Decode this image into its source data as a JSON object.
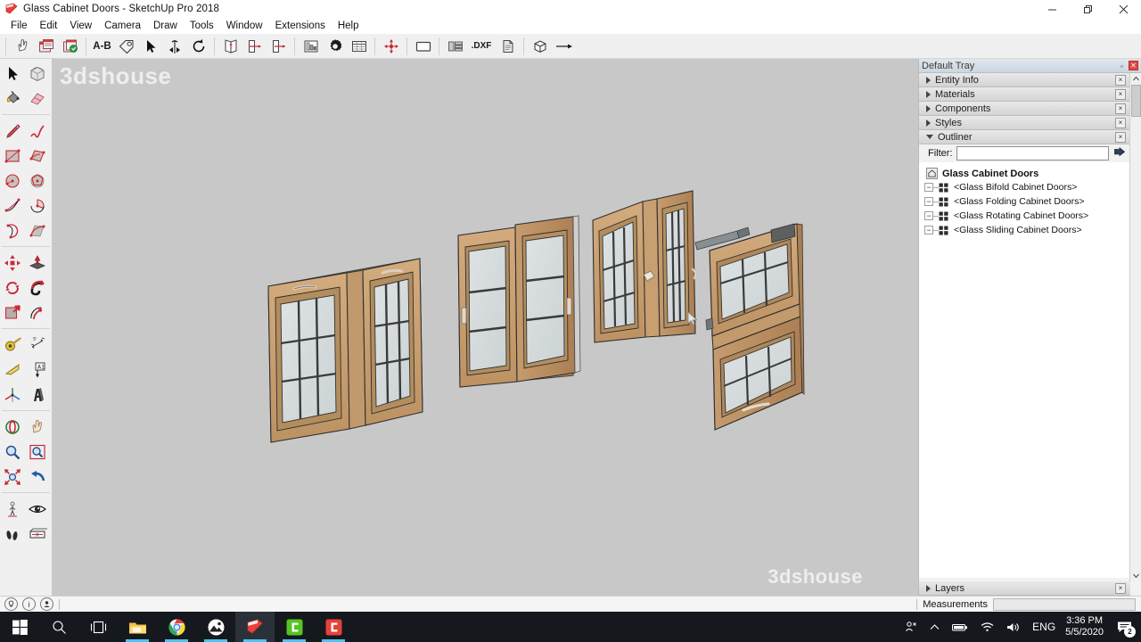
{
  "window": {
    "title": "Glass Cabinet Doors - SketchUp Pro 2018",
    "app_icon": "sketchup-icon",
    "minimize": "–",
    "maximize": "❐",
    "close": "✕"
  },
  "menubar": {
    "items": [
      {
        "label": "File"
      },
      {
        "label": "Edit"
      },
      {
        "label": "View"
      },
      {
        "label": "Camera"
      },
      {
        "label": "Draw"
      },
      {
        "label": "Tools"
      },
      {
        "label": "Window"
      },
      {
        "label": "Extensions"
      },
      {
        "label": "Help"
      }
    ]
  },
  "toolbar_top": {
    "buttons": [
      {
        "name": "select-hand-icon",
        "label": ""
      },
      {
        "name": "layout-open-icon",
        "label": ""
      },
      {
        "name": "layout-export-icon",
        "label": ""
      },
      {
        "name": "ab-label-icon",
        "label": "A-B"
      },
      {
        "name": "tag-icon",
        "label": ""
      },
      {
        "name": "arrow-select-icon",
        "label": ""
      },
      {
        "name": "mirror-icon",
        "label": ""
      },
      {
        "name": "rotate-refresh-icon",
        "label": ""
      },
      {
        "name": "open-door-icon",
        "label": ""
      },
      {
        "name": "door-left-icon",
        "label": ""
      },
      {
        "name": "door-right-icon",
        "label": ""
      },
      {
        "name": "bar-chart-icon",
        "label": ""
      },
      {
        "name": "gear-icon",
        "label": ""
      },
      {
        "name": "table-icon",
        "label": ""
      },
      {
        "name": "move-cross-icon",
        "label": ""
      },
      {
        "name": "rectangle-icon",
        "label": ""
      },
      {
        "name": "panel-layout-icon",
        "label": ""
      },
      {
        "name": "dxf-export-icon",
        "label": ".DXF"
      },
      {
        "name": "print-icon",
        "label": ""
      },
      {
        "name": "cube-icon",
        "label": ""
      },
      {
        "name": "arrow-right-icon",
        "label": ""
      }
    ]
  },
  "toolbar_left": {
    "groups": [
      {
        "tools": [
          {
            "name": "select-arrow-tool",
            "label": "Select"
          },
          {
            "name": "make-component-tool",
            "label": "Make Component"
          },
          {
            "name": "paint-bucket-tool",
            "label": "Paint Bucket"
          },
          {
            "name": "eraser-tool",
            "label": "Eraser"
          }
        ]
      },
      {
        "tools": [
          {
            "name": "line-tool",
            "label": "Line"
          },
          {
            "name": "freehand-tool",
            "label": "Freehand"
          },
          {
            "name": "rectangle-tool",
            "label": "Rectangle"
          },
          {
            "name": "rotated-rectangle-tool",
            "label": "Rotated Rectangle"
          },
          {
            "name": "circle-tool",
            "label": "Circle"
          },
          {
            "name": "polygon-tool",
            "label": "Polygon"
          },
          {
            "name": "arc-tool",
            "label": "Arc"
          },
          {
            "name": "pie-tool",
            "label": "Pie"
          },
          {
            "name": "two-point-arc-tool",
            "label": "2 Point Arc"
          },
          {
            "name": "three-point-arc-tool",
            "label": "3 Point Arc"
          }
        ]
      },
      {
        "tools": [
          {
            "name": "move-tool",
            "label": "Move"
          },
          {
            "name": "pushpull-tool",
            "label": "Push/Pull"
          },
          {
            "name": "rotate-tool",
            "label": "Rotate"
          },
          {
            "name": "followme-tool",
            "label": "Follow Me"
          },
          {
            "name": "scale-tool",
            "label": "Scale"
          },
          {
            "name": "offset-tool",
            "label": "Offset"
          }
        ]
      },
      {
        "tools": [
          {
            "name": "tape-measure-tool",
            "label": "Tape Measure"
          },
          {
            "name": "dimension-tool",
            "label": "Dimension"
          },
          {
            "name": "protractor-tool",
            "label": "Protractor"
          },
          {
            "name": "text-tool",
            "label": "Text"
          },
          {
            "name": "axes-tool",
            "label": "Axes"
          },
          {
            "name": "three-d-text-tool",
            "label": "3D Text"
          }
        ]
      },
      {
        "tools": [
          {
            "name": "orbit-tool",
            "label": "Orbit"
          },
          {
            "name": "pan-tool",
            "label": "Pan"
          },
          {
            "name": "zoom-tool",
            "label": "Zoom"
          },
          {
            "name": "zoom-window-tool",
            "label": "Zoom Window"
          },
          {
            "name": "zoom-extents-tool",
            "label": "Zoom Extents"
          },
          {
            "name": "previous-view-tool",
            "label": "Previous"
          }
        ]
      },
      {
        "tools": [
          {
            "name": "position-camera-tool",
            "label": "Position Camera"
          },
          {
            "name": "look-around-tool",
            "label": "Look Around"
          },
          {
            "name": "walk-tool",
            "label": "Walk"
          },
          {
            "name": "section-plane-tool",
            "label": "Section Plane"
          }
        ]
      }
    ]
  },
  "viewport": {
    "watermark_top": "3dshouse",
    "watermark_bottom": "3dshouse",
    "background_color": "#c8c8c8",
    "wood_color": "#c49a6c",
    "glass_color": "#d5dadb",
    "models": [
      {
        "name": "glass-bifold-cabinet-doors",
        "label": "Glass Bifold Cabinet Doors"
      },
      {
        "name": "glass-sliding-cabinet-doors",
        "label": "Glass Sliding Cabinet Doors"
      },
      {
        "name": "glass-folding-cabinet-doors",
        "label": "Glass Folding Cabinet Doors"
      },
      {
        "name": "glass-rotating-cabinet-doors",
        "label": "Glass Rotating Cabinet Doors"
      }
    ]
  },
  "tray": {
    "title": "Default Tray",
    "pin_glyph": "▫",
    "close_glyph": "✕",
    "panel_close_glyph": "×",
    "panels": [
      {
        "name": "entity-info",
        "label": "Entity Info",
        "expanded": false
      },
      {
        "name": "materials",
        "label": "Materials",
        "expanded": false
      },
      {
        "name": "components",
        "label": "Components",
        "expanded": false
      },
      {
        "name": "styles",
        "label": "Styles",
        "expanded": false
      },
      {
        "name": "outliner",
        "label": "Outliner",
        "expanded": true
      }
    ],
    "layers_panel": {
      "label": "Layers",
      "expanded": false
    },
    "outliner": {
      "filter_label": "Filter:",
      "filter_value": "",
      "filter_placeholder": "",
      "root": "Glass Cabinet Doors",
      "items": [
        {
          "label": "<Glass Bifold Cabinet Doors>"
        },
        {
          "label": "<Glass Folding Cabinet Doors>"
        },
        {
          "label": "<Glass Rotating Cabinet Doors>"
        },
        {
          "label": "<Glass Sliding Cabinet Doors>"
        }
      ],
      "expander_glyph": "−"
    }
  },
  "statusbar": {
    "icons": [
      {
        "name": "tips-bulb-icon",
        "glyph": "○"
      },
      {
        "name": "info-icon",
        "glyph": "i"
      },
      {
        "name": "account-icon",
        "glyph": "●"
      }
    ],
    "measurements_label": "Measurements",
    "measurements_value": ""
  },
  "taskbar": {
    "items": [
      {
        "name": "start-button",
        "label": "Start",
        "active": false,
        "running": false
      },
      {
        "name": "search-button",
        "label": "Search",
        "active": false,
        "running": false
      },
      {
        "name": "task-view-button",
        "label": "Task View",
        "active": false,
        "running": false
      },
      {
        "name": "file-explorer-button",
        "label": "File Explorer",
        "active": false,
        "running": true
      },
      {
        "name": "chrome-button",
        "label": "Google Chrome",
        "active": false,
        "running": true
      },
      {
        "name": "photos-button",
        "label": "Photos",
        "active": false,
        "running": true
      },
      {
        "name": "sketchup-button",
        "label": "SketchUp Pro 2018",
        "active": true,
        "running": true
      },
      {
        "name": "camtasia-button",
        "label": "Camtasia",
        "active": false,
        "running": true
      },
      {
        "name": "camtasia-recorder-button",
        "label": "Camtasia Recorder",
        "active": false,
        "running": true
      }
    ],
    "system_tray": {
      "share_glyph": "⎇",
      "chevron_glyph": "∧",
      "battery_glyph": "▬",
      "wifi_glyph": "◠",
      "volume_glyph": "🔊",
      "language": "ENG",
      "time": "3:36 PM",
      "date": "5/5/2020",
      "notifications_count": "2"
    }
  }
}
